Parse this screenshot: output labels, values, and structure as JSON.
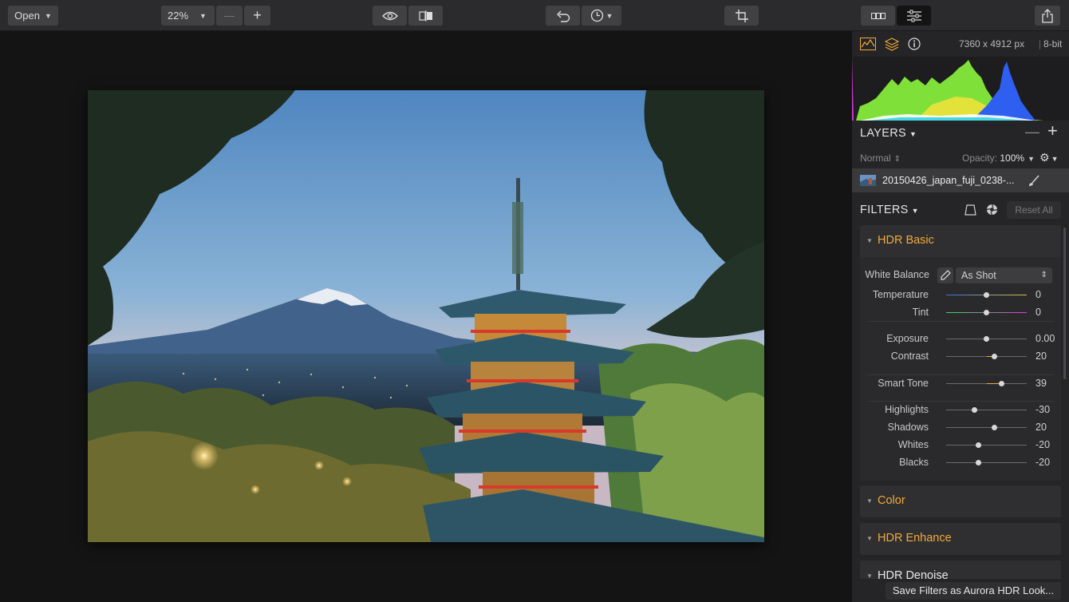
{
  "toolbar": {
    "open_label": "Open",
    "zoom_value": "22%",
    "zoom_out_label": "—",
    "zoom_in_label": "+"
  },
  "image_info": {
    "dimensions": "7360 x 4912 px",
    "bit_depth": "8-bit"
  },
  "layers": {
    "title": "LAYERS",
    "blend_mode": "Normal",
    "opacity_label": "Opacity:",
    "opacity_value": "100%",
    "layer_name": "20150426_japan_fuji_0238-..."
  },
  "filters": {
    "title": "FILTERS",
    "reset_label": "Reset All",
    "hdr_basic": {
      "title": "HDR Basic",
      "white_balance_label": "White Balance",
      "white_balance_value": "As Shot",
      "sliders": [
        {
          "label": "Temperature",
          "value": "0",
          "level": 0.5,
          "fill": false
        },
        {
          "label": "Tint",
          "value": "0",
          "level": 0.5,
          "fill": false
        },
        {
          "label": "Exposure",
          "value": "0.00",
          "level": 0.5,
          "fill": false
        },
        {
          "label": "Contrast",
          "value": "20",
          "level": 0.6,
          "fill": true
        },
        {
          "label": "Smart Tone",
          "value": "39",
          "level": 0.69,
          "fill": true
        },
        {
          "label": "Highlights",
          "value": "-30",
          "level": 0.35,
          "fill": false
        },
        {
          "label": "Shadows",
          "value": "20",
          "level": 0.6,
          "fill": false
        },
        {
          "label": "Whites",
          "value": "-20",
          "level": 0.4,
          "fill": false
        },
        {
          "label": "Blacks",
          "value": "-20",
          "level": 0.4,
          "fill": false
        }
      ]
    },
    "collapsed": [
      {
        "title": "Color"
      },
      {
        "title": "HDR Enhance"
      },
      {
        "title": "HDR Denoise"
      }
    ],
    "save_label": "Save Filters as Aurora HDR Look..."
  },
  "colors": {
    "accent": "#f0a93a",
    "panel": "#252527",
    "toolbar": "#2b2b2d"
  }
}
